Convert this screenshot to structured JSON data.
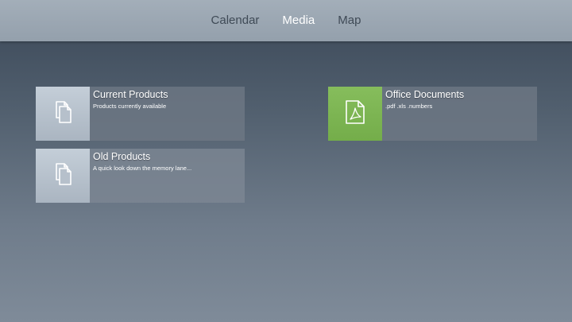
{
  "nav": {
    "tabs": [
      {
        "label": "Calendar",
        "active": false
      },
      {
        "label": "Media",
        "active": true
      },
      {
        "label": "Map",
        "active": false
      }
    ]
  },
  "colors": {
    "active_tab": "#ffffff",
    "inactive_tab": "#3f4a56",
    "pdf_tile_accent": "#7cb552"
  },
  "tiles": [
    {
      "title": "Current Products",
      "subtitle": "Products currently available",
      "icon": "documents-icon"
    },
    {
      "title": "Old Products",
      "subtitle": "A quick look down the memory lane...",
      "icon": "documents-icon"
    },
    {
      "title": "Office Documents",
      "subtitle": ".pdf .xls .numbers",
      "icon": "pdf-document-icon"
    }
  ]
}
